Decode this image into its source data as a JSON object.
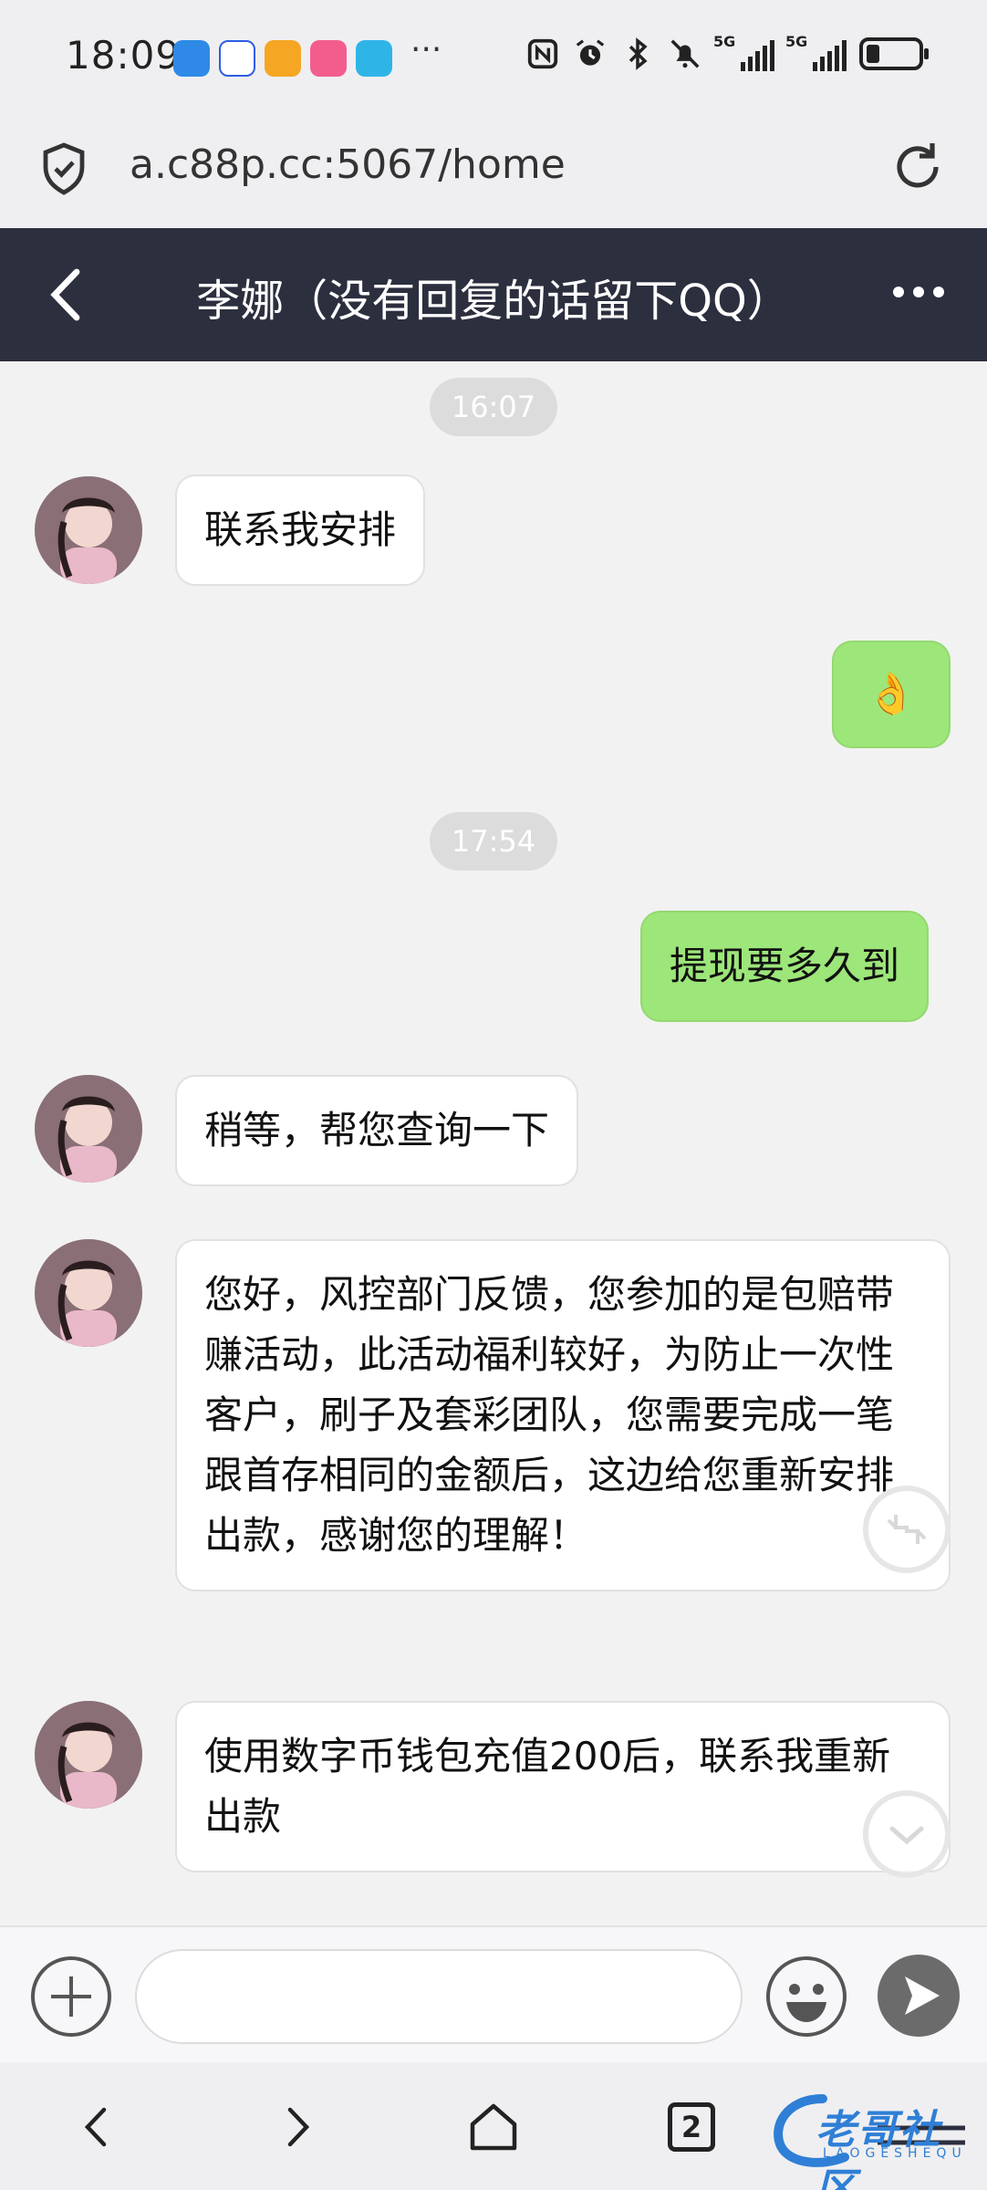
{
  "status": {
    "time": "18:09",
    "more": "···",
    "network_1": "5G",
    "network_2": "5G"
  },
  "browser": {
    "url": "a.c88p.cc:5067/home",
    "tab_count": "2"
  },
  "chat": {
    "title": "李娜（没有回复的话留下QQ）",
    "messages": [
      {
        "type": "time",
        "text": "16:07"
      },
      {
        "type": "received",
        "text": "联系我安排"
      },
      {
        "type": "sent",
        "text": "👌"
      },
      {
        "type": "time",
        "text": "17:54"
      },
      {
        "type": "sent",
        "text": "提现要多久到"
      },
      {
        "type": "received",
        "text": "稍等，帮您查询一下"
      },
      {
        "type": "received",
        "text": "您好，风控部门反馈，您参加的是包赔带赚活动，此活动福利较好，为防止一次性客户，刷子及套彩团队，您需要完成一笔跟首存相同的金额后，这边给您重新安排出款，感谢您的理解！"
      },
      {
        "type": "received",
        "text": "使用数字币钱包充值200后，联系我重新出款"
      }
    ]
  },
  "input": {
    "placeholder": ""
  },
  "watermark": {
    "title": "老哥社区",
    "subtitle": "LAOGESHEQU"
  },
  "colors": {
    "header_bg": "#2c2f3e",
    "sent_bubble": "#9de67a",
    "received_bubble": "#ffffff",
    "chat_bg": "#f2f2f2"
  },
  "icons": {
    "back": "chevron-left-icon",
    "more": "more-horizontal-icon",
    "plus": "plus-circle-icon",
    "emoji": "emoji-icon",
    "send": "send-icon",
    "nav_back": "chevron-left-icon",
    "nav_forward": "chevron-right-icon",
    "home": "home-icon",
    "menu": "menu-icon"
  }
}
